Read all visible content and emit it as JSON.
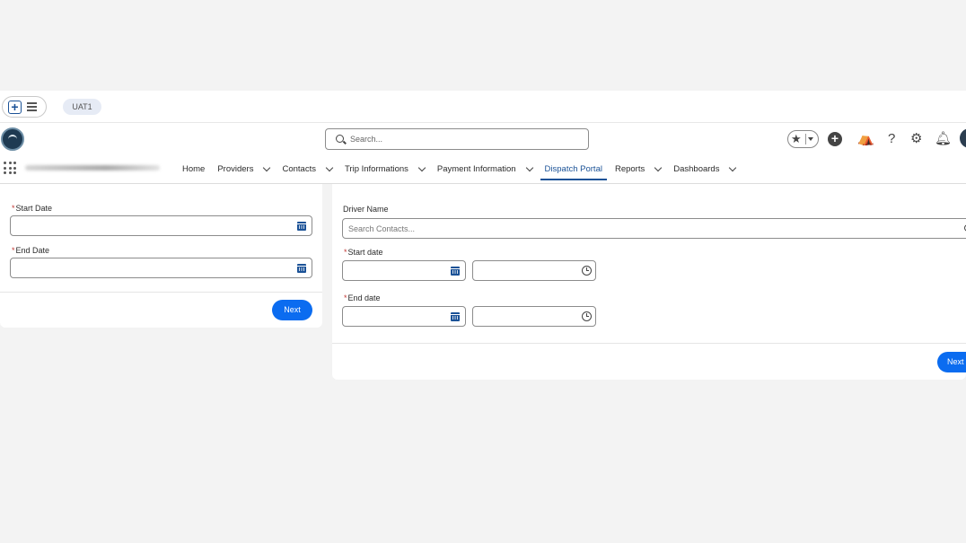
{
  "app_bar": {
    "env_badge": "UAT1"
  },
  "header": {
    "search_placeholder": "Search...",
    "icons": [
      "favorites-star-icon",
      "add-icon",
      "trailhead-icon",
      "help-icon",
      "settings-icon",
      "notifications-bell-icon",
      "user-avatar"
    ]
  },
  "nav": {
    "items": [
      {
        "label": "Home",
        "dropdown": false,
        "active": false
      },
      {
        "label": "Providers",
        "dropdown": true,
        "active": false
      },
      {
        "label": "Contacts",
        "dropdown": true,
        "active": false
      },
      {
        "label": "Trip Informations",
        "dropdown": true,
        "active": false
      },
      {
        "label": "Payment Information",
        "dropdown": true,
        "active": false
      },
      {
        "label": "Dispatch Portal",
        "dropdown": false,
        "active": true
      },
      {
        "label": "Reports",
        "dropdown": true,
        "active": false
      },
      {
        "label": "Dashboards",
        "dropdown": true,
        "active": false
      }
    ]
  },
  "left_form": {
    "start_date_label": "Start Date",
    "end_date_label": "End Date",
    "next_label": "Next"
  },
  "right_form": {
    "driver_name_label": "Driver Name",
    "driver_search_placeholder": "Search Contacts...",
    "start_date_label": "Start date",
    "end_date_label": "End date",
    "next_label": "Next"
  },
  "colors": {
    "brand": "#1b5297",
    "button": "#0b6cf0",
    "required": "#c23934",
    "page_bg": "#f3f3f3"
  }
}
